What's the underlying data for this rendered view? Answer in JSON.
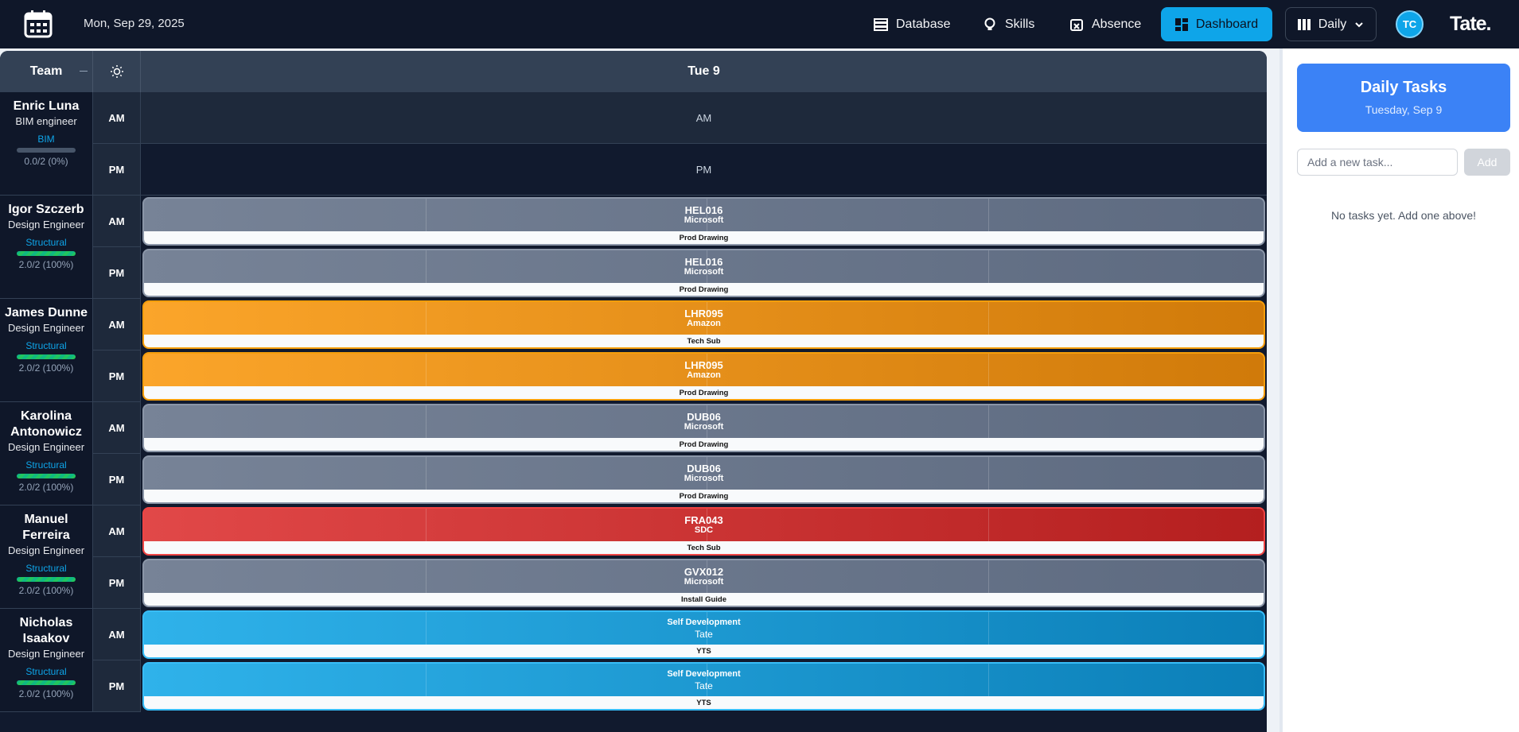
{
  "header": {
    "date": "Mon, Sep 29, 2025",
    "nav": [
      {
        "label": "Database",
        "icon": "database-icon"
      },
      {
        "label": "Skills",
        "icon": "lightbulb-icon"
      },
      {
        "label": "Absence",
        "icon": "calendar-x-icon"
      }
    ],
    "dashboard_label": "Dashboard",
    "view_label": "Daily",
    "avatar_initials": "TC",
    "logo": "Tate."
  },
  "schedule": {
    "team_header": "Team",
    "day_header": "Tue 9",
    "am_label": "AM",
    "pm_label": "PM",
    "people": [
      {
        "name": "Enric Luna",
        "role": "BIM engineer",
        "skill": "BIM",
        "capacity": "0.0/2 (0%)",
        "fill": 0,
        "am": {
          "empty": "AM"
        },
        "pm": {
          "empty": "PM"
        }
      },
      {
        "name": "Igor Szczerb",
        "role": "Design Engineer",
        "skill": "Structural",
        "capacity": "2.0/2 (100%)",
        "fill": 1,
        "am": {
          "code": "HEL016",
          "client": "Microsoft",
          "task": "Prod Drawing",
          "color": "grey"
        },
        "pm": {
          "code": "HEL016",
          "client": "Microsoft",
          "task": "Prod Drawing",
          "color": "grey"
        }
      },
      {
        "name": "James Dunne",
        "role": "Design Engineer",
        "skill": "Structural",
        "capacity": "2.0/2 (100%)",
        "fill": 1,
        "am": {
          "code": "LHR095",
          "client": "Amazon",
          "task": "Tech Sub",
          "color": "orange"
        },
        "pm": {
          "code": "LHR095",
          "client": "Amazon",
          "task": "Prod Drawing",
          "color": "orange"
        }
      },
      {
        "name": "Karolina Antonowicz",
        "role": "Design Engineer",
        "skill": "Structural",
        "capacity": "2.0/2 (100%)",
        "fill": 1,
        "am": {
          "code": "DUB06",
          "client": "Microsoft",
          "task": "Prod Drawing",
          "color": "grey"
        },
        "pm": {
          "code": "DUB06",
          "client": "Microsoft",
          "task": "Prod Drawing",
          "color": "grey"
        }
      },
      {
        "name": "Manuel Ferreira",
        "role": "Design Engineer",
        "skill": "Structural",
        "capacity": "2.0/2 (100%)",
        "fill": 1,
        "am": {
          "code": "FRA043",
          "client": "SDC",
          "task": "Tech Sub",
          "color": "red"
        },
        "pm": {
          "code": "GVX012",
          "client": "Microsoft",
          "task": "Install Guide",
          "color": "grey"
        }
      },
      {
        "name": "Nicholas Isaakov",
        "role": "Design Engineer",
        "skill": "Structural",
        "capacity": "2.0/2 (100%)",
        "fill": 1,
        "am": {
          "code": "Self Development",
          "client": "Tate",
          "task": "YTS",
          "color": "blue"
        },
        "pm": {
          "code": "Self Development",
          "client": "Tate",
          "task": "YTS",
          "color": "blue"
        }
      }
    ]
  },
  "tasks_panel": {
    "title": "Daily Tasks",
    "date": "Tuesday, Sep 9",
    "input_placeholder": "Add a new task...",
    "add_label": "Add",
    "empty_message": "No tasks yet. Add one above!"
  }
}
